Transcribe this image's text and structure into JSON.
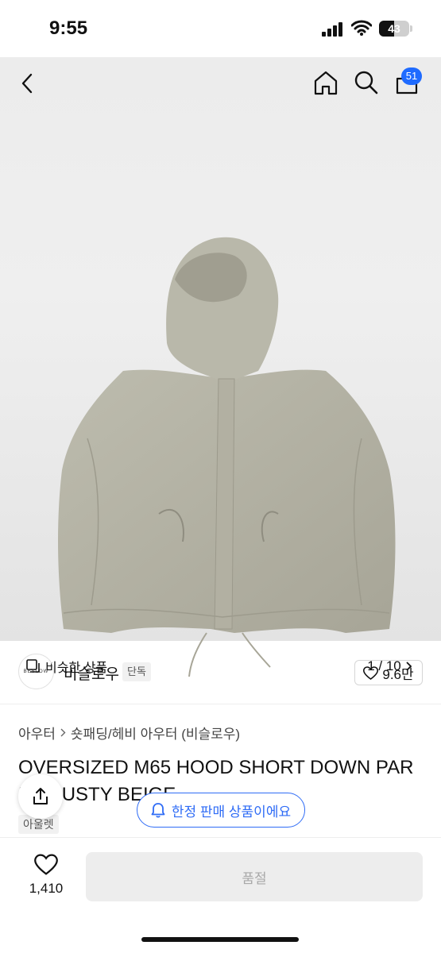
{
  "status_bar": {
    "time": "9:55",
    "battery": "43"
  },
  "nav": {
    "cart_count": "51"
  },
  "image": {
    "similar_label": "비슷한 상품",
    "pager": "1 / 10"
  },
  "brand": {
    "logo_text": "BESLOW",
    "name": "비슬로우",
    "exclusive_badge": "단독",
    "likes": "9.6만"
  },
  "breadcrumb": {
    "level1": "아우터",
    "level2": "숏패딩/헤비 아우터 (비슬로우)"
  },
  "product": {
    "title_line1": "OVERSIZED M65 HOOD SHORT DOWN PAR",
    "title_line2": "KA DUSTY BEIGE",
    "outlet_badge": "아울렛"
  },
  "notice": {
    "limited_label": "한정 판매 상품이에요"
  },
  "bottom_bar": {
    "like_count": "1,410",
    "soldout_label": "품절"
  },
  "colors": {
    "accent": "#2f6cf6",
    "badge": "#1f6bff",
    "jacket": "#b3b1a3"
  }
}
